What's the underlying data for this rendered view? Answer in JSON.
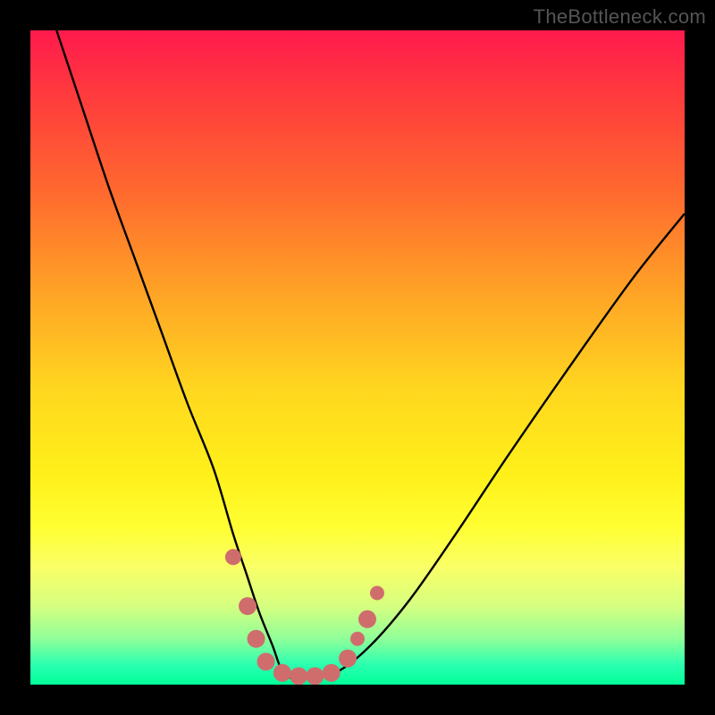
{
  "watermark": "TheBottleneck.com",
  "colors": {
    "frame": "#000000",
    "curve": "#000000",
    "marker": "#cf6d6d",
    "gradient_top": "#ff1a4d",
    "gradient_bottom": "#00ff99"
  },
  "chart_data": {
    "type": "line",
    "title": "",
    "xlabel": "",
    "ylabel": "",
    "xlim": [
      0,
      100
    ],
    "ylim": [
      0,
      100
    ],
    "series": [
      {
        "name": "bottleneck-curve",
        "x": [
          4,
          8,
          12,
          16,
          20,
          24,
          28,
          31,
          33,
          35,
          37,
          38.5,
          40,
          43,
          47,
          52,
          58,
          65,
          73,
          82,
          92,
          100
        ],
        "y": [
          100,
          88,
          76,
          65,
          54,
          43,
          33,
          23,
          17,
          11,
          6,
          2,
          1,
          1,
          2,
          6,
          13,
          23,
          35,
          48,
          62,
          72
        ]
      }
    ],
    "markers": [
      {
        "x": 31.0,
        "y": 19.5,
        "r": 9
      },
      {
        "x": 33.2,
        "y": 12.0,
        "r": 10
      },
      {
        "x": 34.5,
        "y": 7.0,
        "r": 10
      },
      {
        "x": 36.0,
        "y": 3.5,
        "r": 10
      },
      {
        "x": 38.5,
        "y": 1.8,
        "r": 10
      },
      {
        "x": 41.0,
        "y": 1.3,
        "r": 10
      },
      {
        "x": 43.5,
        "y": 1.3,
        "r": 10
      },
      {
        "x": 46.0,
        "y": 1.8,
        "r": 10
      },
      {
        "x": 48.5,
        "y": 4.0,
        "r": 10
      },
      {
        "x": 50.0,
        "y": 7.0,
        "r": 8
      },
      {
        "x": 51.5,
        "y": 10.0,
        "r": 10
      },
      {
        "x": 53.0,
        "y": 14.0,
        "r": 8
      }
    ]
  }
}
